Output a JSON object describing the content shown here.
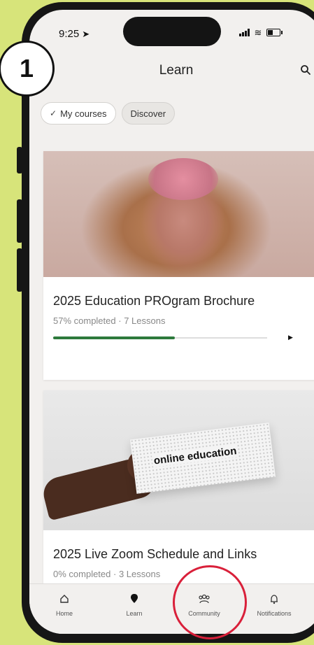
{
  "status": {
    "time": "9:25"
  },
  "header": {
    "title": "Learn"
  },
  "chips": [
    {
      "label": "My courses",
      "active": true
    },
    {
      "label": "Discover",
      "active": false
    }
  ],
  "courses": [
    {
      "title": "2025 Education PROgram Brochure",
      "progress_label": "57% completed",
      "lessons": "7 Lessons",
      "progress": 0.57
    },
    {
      "title": "2025 Live Zoom Schedule and Links",
      "progress_label": "0% completed",
      "lessons": "3 Lessons",
      "progress": 0.0,
      "image_text": "online education"
    }
  ],
  "tabs": [
    {
      "label": "Home",
      "icon": "home-icon"
    },
    {
      "label": "Learn",
      "icon": "learn-icon"
    },
    {
      "label": "Community",
      "icon": "community-icon"
    },
    {
      "label": "Notifications",
      "icon": "bell-icon"
    }
  ],
  "annotation": {
    "step": "1",
    "highlight_color": "#d9203a"
  },
  "colors": {
    "background": "#d7e47a",
    "progress": "#2d7a3c"
  }
}
